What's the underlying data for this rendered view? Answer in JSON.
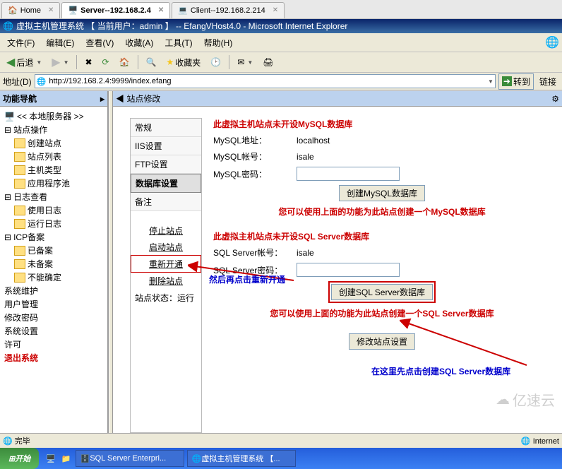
{
  "tabs": [
    {
      "label": "Home"
    },
    {
      "label": "Server--192.168.2.4"
    },
    {
      "label": "Client--192.168.2.214"
    }
  ],
  "title": "虚拟主机管理系统 【 当前用户：admin 】 -- EfangVHost4.0 - Microsoft Internet Explorer",
  "menu": {
    "file": "文件(F)",
    "edit": "编辑(E)",
    "view": "查看(V)",
    "favorites": "收藏(A)",
    "tools": "工具(T)",
    "help": "帮助(H)"
  },
  "toolbar": {
    "back": "后退",
    "favorites": "收藏夹"
  },
  "addr": {
    "label": "地址(D)",
    "url": "http://192.168.2.4:9999/index.efang",
    "go": "转到",
    "links": "链接"
  },
  "nav": {
    "header": "功能导航",
    "server": "<< 本地服务器 >>",
    "site_ops": "站点操作",
    "create_site": "创建站点",
    "site_list": "站点列表",
    "host_types": "主机类型",
    "app_pool": "应用程序池",
    "log_view": "日志查看",
    "use_log": "使用日志",
    "run_log": "运行日志",
    "icp": "ICP备案",
    "done": "已备案",
    "undone": "未备案",
    "unknown": "不能确定",
    "sys_maint": "系统维护",
    "user_mgmt": "用户管理",
    "change_pwd": "修改密码",
    "sys_config": "系统设置",
    "permit": "许可",
    "exit": "退出系统"
  },
  "main": {
    "header": "◀ 站点修改",
    "left_tabs": {
      "general": "常规",
      "iis": "IIS设置",
      "ftp": "FTP设置",
      "db": "数据库设置",
      "notes": "备注"
    },
    "left_actions": {
      "stop": "停止站点",
      "start": "启动站点",
      "reopen": "重新开通",
      "delete": "删除站点"
    },
    "status_label": "站点状态：",
    "status_value": "运行",
    "mysql": {
      "warn": "此虚拟主机站点未开设MySQL数据库",
      "addr_lbl": "MySQL地址：",
      "addr_val": "localhost",
      "acct_lbl": "MySQL帐号：",
      "acct_val": "isale",
      "pwd_lbl": "MySQL密码：",
      "create_btn": "创建MySQL数据库",
      "hint": "您可以使用上面的功能为此站点创建一个MySQL数据库"
    },
    "mssql": {
      "warn": "此虚拟主机站点未开设SQL Server数据库",
      "acct_lbl": "SQL Server帐号：",
      "acct_val": "isale",
      "pwd_lbl": "SQL Server密码：",
      "create_btn": "创建SQL Server数据库",
      "hint": "您可以使用上面的功能为此站点创建一个SQL Server数据库"
    },
    "save_btn": "修改站点设置"
  },
  "annotations": {
    "reopen_hint": "然后再点击重新开通",
    "create_hint": "在这里先点击创建SQL Server数据库"
  },
  "status": {
    "done": "完毕",
    "zone": "Internet"
  },
  "taskbar": {
    "start": "开始",
    "task1": "SQL Server Enterpri...",
    "task2": "虚拟主机管理系统 【..."
  },
  "watermark": "亿速云"
}
